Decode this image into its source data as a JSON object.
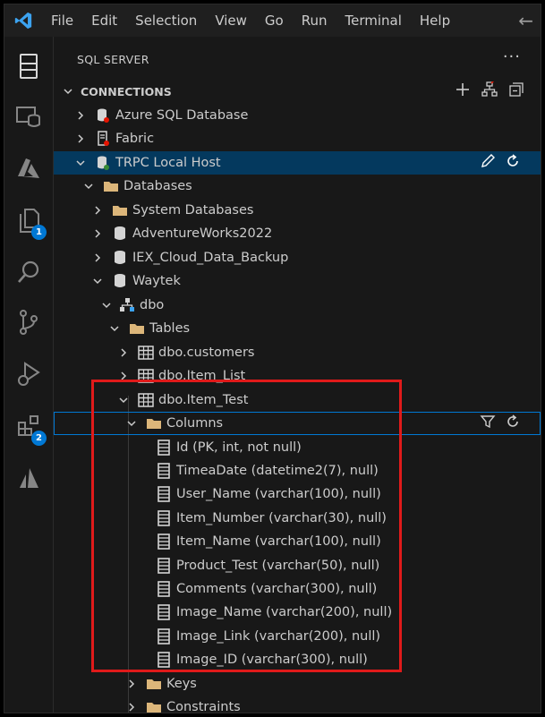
{
  "titlebar": {
    "menu": [
      "File",
      "Edit",
      "Selection",
      "View",
      "Go",
      "Run",
      "Terminal",
      "Help"
    ]
  },
  "activitybar": {
    "items": [
      {
        "icon": "sql-server-icon"
      },
      {
        "icon": "database-projects-icon"
      },
      {
        "icon": "azure-icon"
      },
      {
        "icon": "explorer-icon",
        "badge": "1"
      },
      {
        "icon": "search-icon"
      },
      {
        "icon": "source-control-icon"
      },
      {
        "icon": "run-debug-icon"
      },
      {
        "icon": "extensions-icon",
        "badge": "2"
      },
      {
        "icon": "azure-data-icon"
      }
    ]
  },
  "sidebar": {
    "title": "SQL SERVER",
    "section": "CONNECTIONS",
    "connections": {
      "azure": "Azure SQL Database",
      "fabric": "Fabric",
      "local": "TRPC Local Host",
      "databases": "Databases",
      "system_dbs": "System Databases",
      "adventureworks": "AdventureWorks2022",
      "iex": "IEX_Cloud_Data_Backup",
      "waytek": "Waytek",
      "dbo": "dbo",
      "tables": "Tables",
      "customers": "dbo.customers",
      "item_list": "dbo.Item_List",
      "item_test": "dbo.Item_Test",
      "columns": "Columns",
      "keys": "Keys",
      "constraints": "Constraints"
    },
    "columns": [
      "Id (PK, int, not null)",
      "TimeaDate (datetime2(7), null)",
      "User_Name (varchar(100), null)",
      "Item_Number (varchar(30), null)",
      "Item_Name (varchar(100), null)",
      "Product_Test (varchar(50), null)",
      "Comments (varchar(300), null)",
      "Image_Name (varchar(200), null)",
      "Image_Link (varchar(200), null)",
      "Image_ID (varchar(300), null)"
    ]
  },
  "colors": {
    "accent": "#0078d4",
    "selection": "#04395e",
    "highlight_box": "#e01a1a",
    "folder": "#dcb67a",
    "status_red": "#e51400",
    "status_green": "#388a34"
  }
}
